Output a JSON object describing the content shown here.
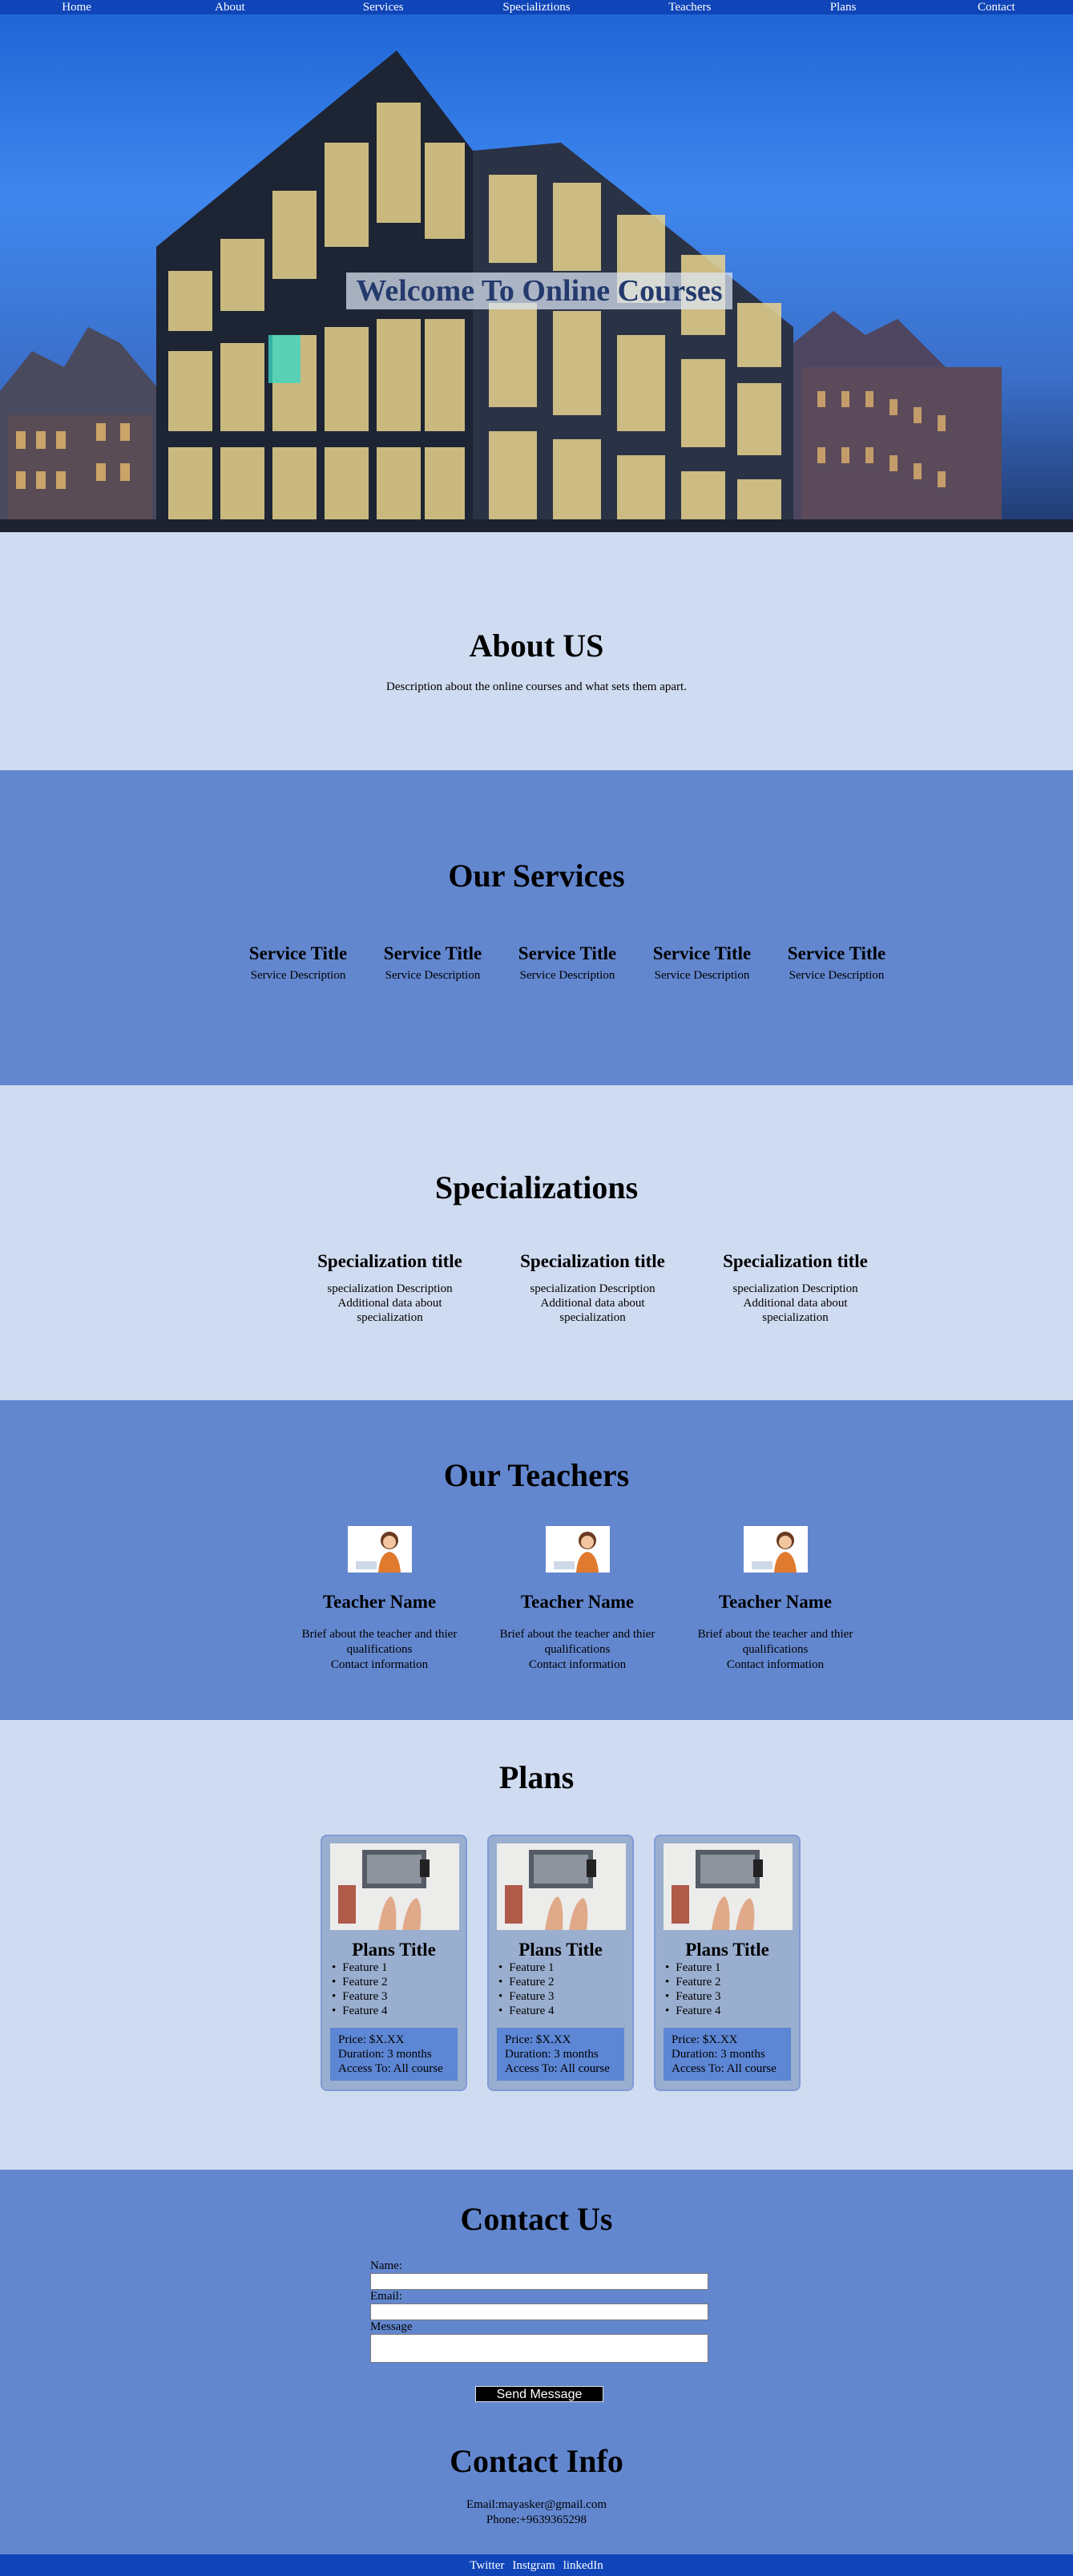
{
  "nav": [
    "Home",
    "About",
    "Services",
    "Specializtions",
    "Teachers",
    "Plans",
    "Contact"
  ],
  "hero": {
    "title": "Welcome To Online Courses"
  },
  "about": {
    "title": "About US",
    "text": "Description about the online courses and what sets them apart."
  },
  "services": {
    "title": "Our Services",
    "items": [
      {
        "title": "Service Title",
        "desc": "Service Description"
      },
      {
        "title": "Service Title",
        "desc": "Service Description"
      },
      {
        "title": "Service Title",
        "desc": "Service Description"
      },
      {
        "title": "Service Title",
        "desc": "Service Description"
      },
      {
        "title": "Service Title",
        "desc": "Service Description"
      }
    ]
  },
  "specializations": {
    "title": "Specializations",
    "items": [
      {
        "title": "Specialization title",
        "desc": "specialization Description",
        "extra": "Additional data about specialization"
      },
      {
        "title": "Specialization title",
        "desc": "specialization Description",
        "extra": "Additional data about specialization"
      },
      {
        "title": "Specialization title",
        "desc": "specialization Description",
        "extra": "Additional data about specialization"
      }
    ]
  },
  "teachers": {
    "title": "Our Teachers",
    "items": [
      {
        "name": "Teacher Name",
        "brief": "Brief about the teacher and thier qualifications",
        "contact": "Contact information"
      },
      {
        "name": "Teacher Name",
        "brief": "Brief about the teacher and thier qualifications",
        "contact": "Contact information"
      },
      {
        "name": "Teacher Name",
        "brief": "Brief about the teacher and thier qualifications",
        "contact": "Contact information"
      }
    ]
  },
  "plans": {
    "title": "Plans",
    "items": [
      {
        "title": "Plans Title",
        "features": [
          "Feature 1",
          "Feature 2",
          "Feature 3",
          "Feature 4"
        ],
        "price": "Price: $X.XX",
        "duration": "Duration: 3 months",
        "access": "Access To: All course"
      },
      {
        "title": "Plans Title",
        "features": [
          "Feature 1",
          "Feature 2",
          "Feature 3",
          "Feature 4"
        ],
        "price": "Price: $X.XX",
        "duration": "Duration: 3 months",
        "access": "Access To: All course"
      },
      {
        "title": "Plans Title",
        "features": [
          "Feature 1",
          "Feature 2",
          "Feature 3",
          "Feature 4"
        ],
        "price": "Price: $X.XX",
        "duration": "Duration: 3 months",
        "access": "Access To: All course"
      }
    ]
  },
  "contact": {
    "title": "Contact Us",
    "name_label": "Name:",
    "email_label": "Email:",
    "message_label": "Message",
    "send_label": "Send Message",
    "info_title": "Contact Info",
    "email": "Email:mayasker@gmail.com",
    "phone": "Phone:+9639365298"
  },
  "footer": [
    "Twitter",
    "Instgram",
    "linkedIn"
  ],
  "colors": {
    "nav": "#0f45b8",
    "light": "#cfdbf0",
    "mid": "#6387cf",
    "plan_card": "#9aaecf",
    "plan_info": "#5d86d4"
  }
}
